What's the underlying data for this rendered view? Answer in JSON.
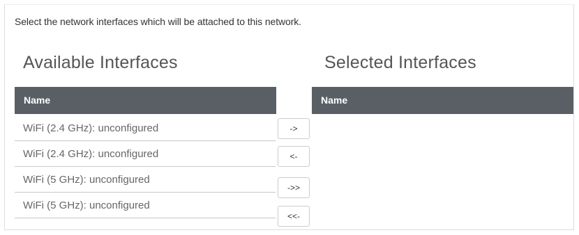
{
  "instructions": "Select the network interfaces which will be attached to this network.",
  "available": {
    "title": "Available Interfaces",
    "column_header": "Name",
    "items": [
      {
        "label": "WiFi (2.4 GHz): unconfigured"
      },
      {
        "label": "WiFi (2.4 GHz): unconfigured"
      },
      {
        "label": "WiFi (5 GHz): unconfigured"
      },
      {
        "label": "WiFi (5 GHz): unconfigured"
      }
    ]
  },
  "selected": {
    "title": "Selected Interfaces",
    "column_header": "Name",
    "items": []
  },
  "buttons": {
    "add": "->",
    "remove": "<-",
    "add_all": "->>",
    "remove_all": "<<-"
  },
  "colors": {
    "header_bg": "#5a5f66",
    "header_text": "#ffffff"
  }
}
